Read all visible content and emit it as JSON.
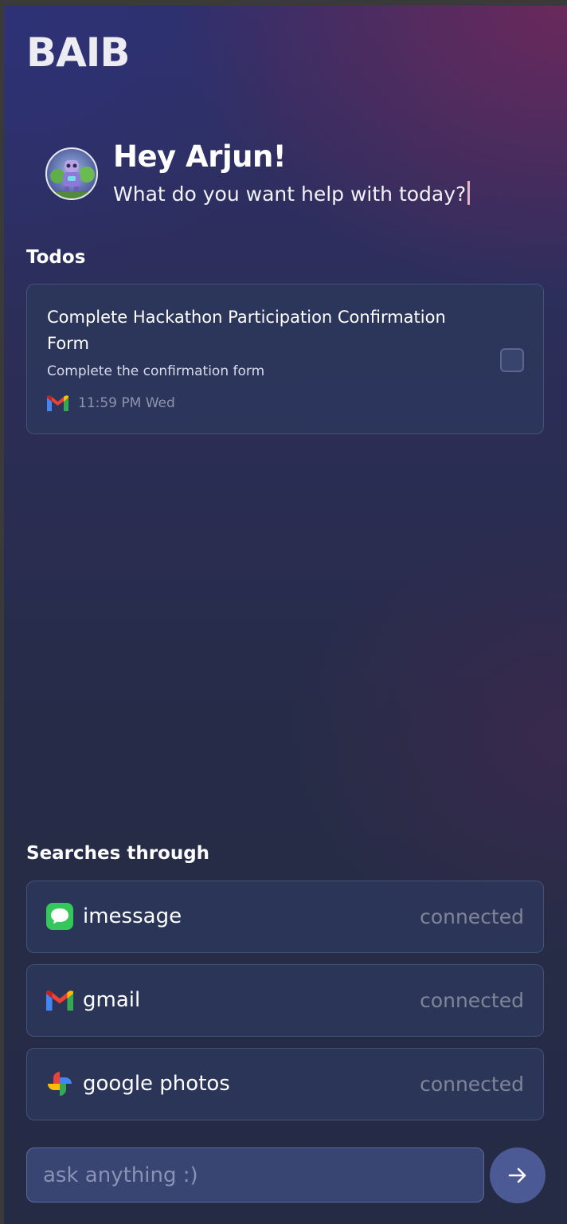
{
  "app": {
    "logo": "BAIB"
  },
  "greeting": {
    "title": "Hey Arjun!",
    "subtitle": "What do you want help with today?"
  },
  "todos": {
    "heading": "Todos",
    "items": [
      {
        "title": "Complete Hackathon Participation Confirmation Form",
        "description": "Complete the confirmation form",
        "source_icon": "gmail-icon",
        "time": "11:59 PM Wed",
        "checked": false
      }
    ]
  },
  "sources": {
    "heading": "Searches through",
    "items": [
      {
        "name": "imessage",
        "status": "connected",
        "icon": "imessage-icon"
      },
      {
        "name": "gmail",
        "status": "connected",
        "icon": "gmail-icon"
      },
      {
        "name": "google photos",
        "status": "connected",
        "icon": "google-photos-icon"
      }
    ]
  },
  "composer": {
    "placeholder": "ask anything :)",
    "send_icon": "arrow-right-icon"
  },
  "colors": {
    "accent": "#4b5a94",
    "card": "#2d375c",
    "status_text": "#7f8599"
  }
}
